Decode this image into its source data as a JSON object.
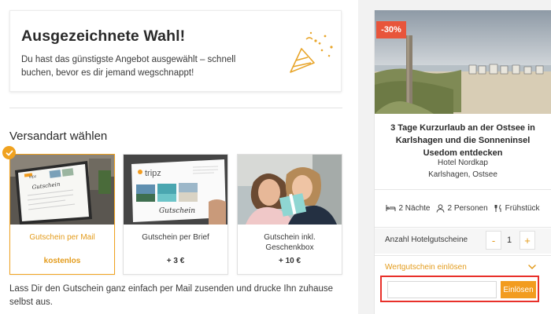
{
  "notice": {
    "title": "Ausgezeichnete Wahl!",
    "text": "Du hast das günstigste Angebot ausgewählt – schnell buchen, bevor es dir jemand wegschnappt!"
  },
  "shipping": {
    "title": "Versandart wählen",
    "options": [
      {
        "name": "Gutschein per Mail",
        "price": "kostenlos",
        "selected": true
      },
      {
        "name": "Gutschein per Brief",
        "price": "+ 3 €",
        "selected": false
      },
      {
        "name": "Gutschein inkl. Geschenkbox",
        "price": "+ 10 €",
        "selected": false
      }
    ],
    "thumb_brand": "tripz",
    "thumb_script": "Gutschein",
    "footer_text": "Lass Dir den Gutschein ganz einfach per Mail zusenden und drucke Ihn zuhause selbst aus."
  },
  "offer": {
    "discount": "-30%",
    "title": "3 Tage Kurzurlaub an der Ostsee in Karlshagen und die Sonneninsel Usedom entdecken",
    "hotel": "Hotel Nordkap",
    "location": "Karlshagen, Ostsee",
    "features": [
      {
        "icon": "bed-icon",
        "label": "2 Nächte"
      },
      {
        "icon": "person-icon",
        "label": "2 Personen"
      },
      {
        "icon": "breakfast-icon",
        "label": "Frühstück"
      }
    ],
    "count_label": "Anzahl Hotelgutscheine",
    "count_value": "1",
    "minus_label": "-",
    "plus_label": "+",
    "voucher_label": "Wertgutschein einlösen",
    "redeem_placeholder": "",
    "redeem_button": "Einlösen"
  },
  "colors": {
    "accent": "#f0a21f",
    "accent_text": "#e39b1b",
    "discount": "#e8553b",
    "highlight_box": "#e8302a"
  }
}
